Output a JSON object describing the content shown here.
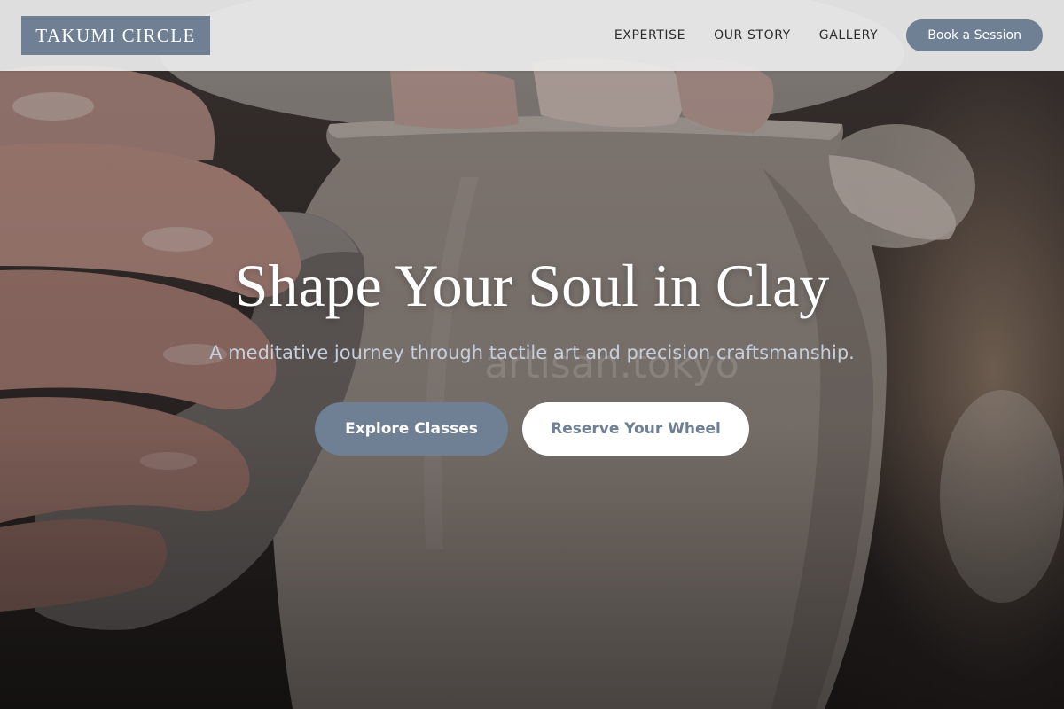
{
  "brand": {
    "logo_text": "TAKUMI CIRCLE",
    "accent_color": "#6f7f94"
  },
  "nav": {
    "links": [
      "EXPERTISE",
      "OUR STORY",
      "GALLERY"
    ],
    "cta_label": "Book a Session"
  },
  "hero": {
    "title": "Shape Your Soul in Clay",
    "subtitle": "A meditative journey through tactile art and precision craftsmanship.",
    "watermark": "artisan.tokyo",
    "primary_button": "Explore Classes",
    "secondary_button": "Reserve Your Wheel",
    "background_image": "hands-shaping-clay-vase-on-wheel"
  }
}
